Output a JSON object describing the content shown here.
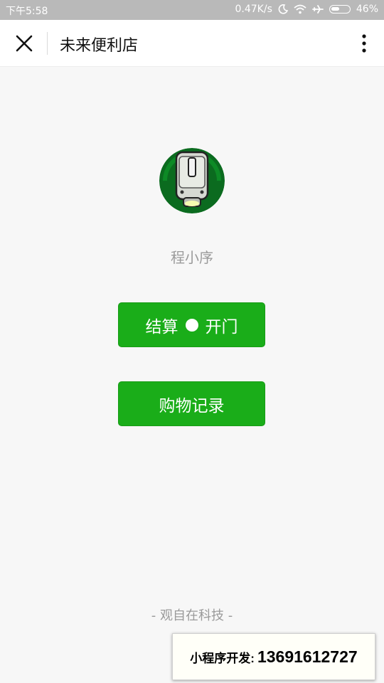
{
  "status_bar": {
    "time": "下午5:58",
    "network_speed": "0.47K/s",
    "battery_percent": "46%",
    "icons": [
      "moon-icon",
      "wifi-icon",
      "airplane-icon",
      "battery-icon"
    ]
  },
  "nav": {
    "title": "未来便利店",
    "close_icon": "close-icon",
    "more_icon": "more-vertical-icon"
  },
  "profile": {
    "name": "程小序",
    "avatar_icon": "robot-avatar"
  },
  "actions": {
    "checkout_label": "结算",
    "open_door_label": "开门",
    "history_label": "购物记录"
  },
  "footer": {
    "text": "- 观自在科技 -"
  },
  "ad": {
    "label": "小程序开发:",
    "phone": "13691612727"
  },
  "colors": {
    "primary": "#1aad19",
    "status_bar": "#b9b9b9",
    "background": "#f7f7f7"
  }
}
